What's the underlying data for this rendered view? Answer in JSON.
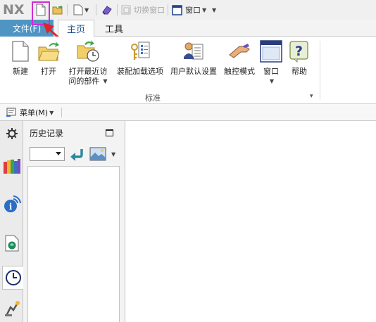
{
  "quick_access": {
    "logo": "NX",
    "switch_window_label": "切换窗口",
    "window_label": "窗口"
  },
  "tabs": {
    "file": "文件(F)",
    "home": "主页",
    "tools": "工具"
  },
  "ribbon": {
    "buttons": [
      {
        "label": "新建",
        "icon": "new-file-icon"
      },
      {
        "label": "打开",
        "icon": "open-folder-icon"
      },
      {
        "label": "打开最近访问的部件",
        "line1": "打开最近访",
        "line2": "问的部件",
        "icon": "open-recent-icon"
      },
      {
        "label": "装配加载选项",
        "icon": "assembly-load-options-icon"
      },
      {
        "label": "用户默认设置",
        "icon": "user-defaults-icon"
      },
      {
        "label": "触控模式",
        "icon": "touch-mode-icon"
      },
      {
        "label": "窗口",
        "icon": "window-icon"
      },
      {
        "label": "帮助",
        "icon": "help-icon"
      }
    ],
    "group_label": "标准"
  },
  "menu_bar": {
    "menu_label": "菜单(M)"
  },
  "history_panel": {
    "title": "历史记录"
  },
  "colors": {
    "file_tab": "#4e95c4",
    "highlight_box": "#d32ad6",
    "arrow": "#e0242b"
  }
}
